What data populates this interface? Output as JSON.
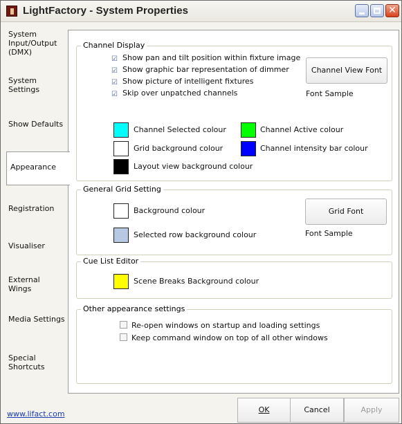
{
  "window": {
    "title": "LightFactory - System Properties",
    "icon": "lightfactory-app-icon",
    "controls": {
      "minimize": "_",
      "maximize": "□",
      "close": "✕"
    }
  },
  "tabs": [
    {
      "label": "System Input/Output (DMX)",
      "active": false
    },
    {
      "label": "System Settings",
      "active": false
    },
    {
      "label": "Show Defaults",
      "active": false
    },
    {
      "label": "Appearance",
      "active": true
    },
    {
      "label": "Registration",
      "active": false
    },
    {
      "label": "Visualiser",
      "active": false
    },
    {
      "label": "External Wings",
      "active": false
    },
    {
      "label": "Media Settings",
      "active": false
    },
    {
      "label": "Special Shortcuts",
      "active": false
    }
  ],
  "channel_display": {
    "legend": "Channel Display",
    "checkboxes": [
      {
        "label": "Show pan and tilt position within fixture image",
        "checked": true
      },
      {
        "label": "Show graphic bar representation of dimmer",
        "checked": true
      },
      {
        "label": "Show picture of intelligent fixtures",
        "checked": true
      },
      {
        "label": "Skip over unpatched channels",
        "checked": true
      }
    ],
    "font_button": "Channel View Font",
    "font_sample": "Font Sample",
    "colours": [
      {
        "label": "Channel Selected colour",
        "color": "#00ffff"
      },
      {
        "label": "Channel Active colour",
        "color": "#00ff00"
      },
      {
        "label": "Grid background colour",
        "color": "#ffffff"
      },
      {
        "label": "Channel intensity bar colour",
        "color": "#0000ff"
      },
      {
        "label": "Layout view background colour",
        "color": "#000000"
      }
    ]
  },
  "grid": {
    "legend": "General Grid Setting",
    "colours": [
      {
        "label": "Background colour",
        "color": "#ffffff"
      },
      {
        "label": "Selected row background colour",
        "color": "#b7c9e2"
      }
    ],
    "font_button": "Grid Font",
    "font_sample": "Font Sample"
  },
  "cue_list": {
    "legend": "Cue List Editor",
    "colours": [
      {
        "label": "Scene Breaks Background colour",
        "color": "#ffff00"
      }
    ]
  },
  "other": {
    "legend": "Other appearance settings",
    "checkboxes": [
      {
        "label": "Re-open windows on startup and loading settings",
        "checked": false
      },
      {
        "label": "Keep command window on top of all other windows",
        "checked": false
      }
    ]
  },
  "footer": {
    "link": "www.lifact.com",
    "ok": "OK",
    "cancel": "Cancel",
    "apply": "Apply"
  }
}
